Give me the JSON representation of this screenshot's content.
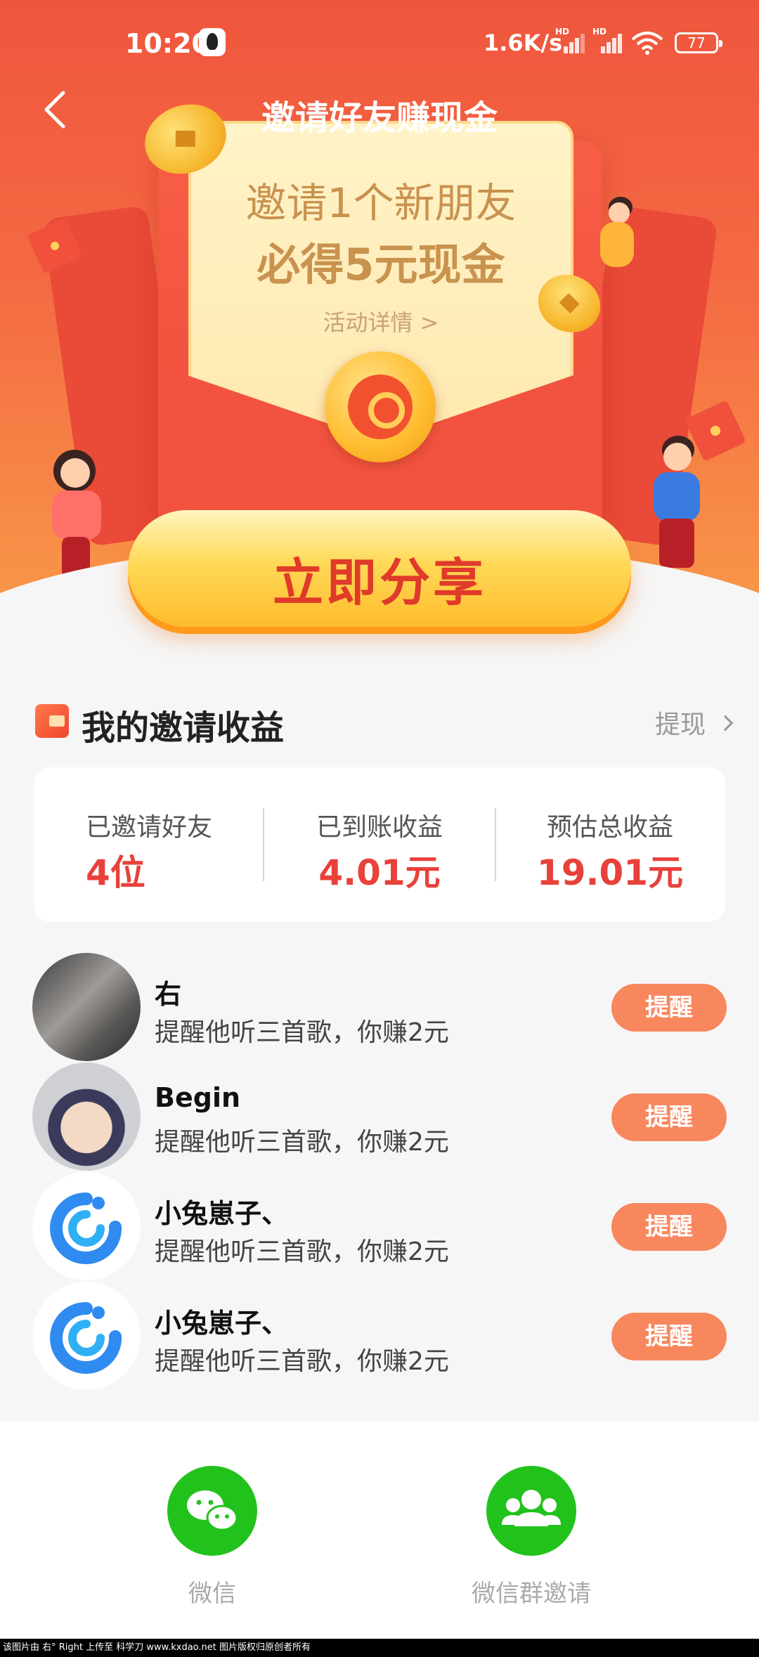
{
  "status_bar": {
    "time": "10:20",
    "network_speed": "1.6K/s",
    "signal_badge_1": "HD",
    "signal_badge_2": "HD",
    "battery": "77"
  },
  "header": {
    "title": "邀请好友赚现金"
  },
  "promo": {
    "line1": "邀请1个新朋友",
    "line2": "必得5元现金",
    "details_link": "活动详情 >"
  },
  "share_button": "立即分享",
  "earnings": {
    "title": "我的邀请收益",
    "withdraw_label": "提现",
    "stats": [
      {
        "label": "已邀请好友",
        "value": "4位"
      },
      {
        "label": "已到账收益",
        "value": "4.01元"
      },
      {
        "label": "预估总收益",
        "value": "19.01元"
      }
    ]
  },
  "friends": [
    {
      "name": "右",
      "desc": "提醒他听三首歌，你赚2元",
      "action": "提醒"
    },
    {
      "name": "Begin",
      "desc": "提醒他听三首歌，你赚2元",
      "action": "提醒"
    },
    {
      "name": "小兔崽子、",
      "desc": "提醒他听三首歌，你赚2元",
      "action": "提醒"
    },
    {
      "name": "小兔崽子、",
      "desc": "提醒他听三首歌，你赚2元",
      "action": "提醒"
    }
  ],
  "share_options": [
    {
      "label": "微信",
      "icon": "wechat-icon"
    },
    {
      "label": "微信群邀请",
      "icon": "group-icon"
    }
  ],
  "watermark": "该图片由 右° Right 上传至 科学刀 www.kxdao.net 图片版权归原创者所有",
  "colors": {
    "accent_red": "#e8413a",
    "remind_button": "#f8875e",
    "wechat_green": "#22c21c"
  }
}
